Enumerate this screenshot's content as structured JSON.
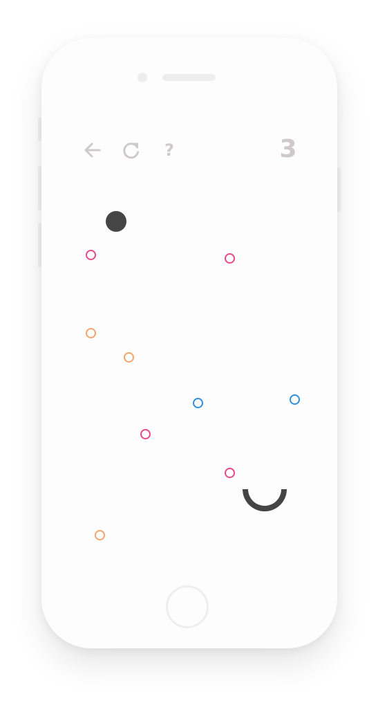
{
  "level": "3",
  "toolbar": {
    "back_icon": "arrow-left-icon",
    "restart_icon": "refresh-icon",
    "help_label": "?"
  },
  "colors": {
    "ui_gray": "#cfc9cb",
    "ball": "#454545",
    "goal": "#454545",
    "pink": "#e8478a",
    "orange": "#f3a46a",
    "blue": "#2e8ede"
  },
  "dots": [
    {
      "color": "pink"
    },
    {
      "color": "pink"
    },
    {
      "color": "orange"
    },
    {
      "color": "orange"
    },
    {
      "color": "blue"
    },
    {
      "color": "blue"
    },
    {
      "color": "pink"
    },
    {
      "color": "pink"
    },
    {
      "color": "orange"
    }
  ]
}
